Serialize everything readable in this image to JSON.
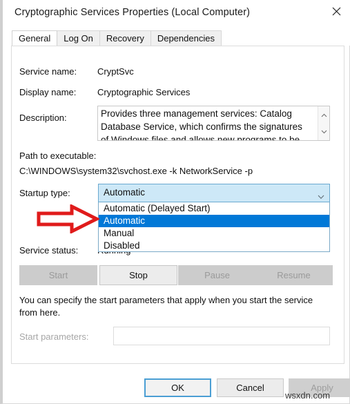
{
  "window": {
    "title": "Cryptographic Services Properties (Local Computer)",
    "close_icon": "close-icon"
  },
  "tabs": [
    {
      "label": "General",
      "active": true
    },
    {
      "label": "Log On",
      "active": false
    },
    {
      "label": "Recovery",
      "active": false
    },
    {
      "label": "Dependencies",
      "active": false
    }
  ],
  "general": {
    "service_name_label": "Service name:",
    "service_name_value": "CryptSvc",
    "display_name_label": "Display name:",
    "display_name_value": "Cryptographic Services",
    "description_label": "Description:",
    "description_value": "Provides three management services: Catalog Database Service, which confirms the signatures of Windows files and allows new programs to be",
    "path_label": "Path to executable:",
    "path_value": "C:\\WINDOWS\\system32\\svchost.exe -k NetworkService -p",
    "startup_type_label": "Startup type:",
    "startup_type_value": "Automatic",
    "startup_type_options": [
      {
        "label": "Automatic (Delayed Start)",
        "selected": false
      },
      {
        "label": "Automatic",
        "selected": true
      },
      {
        "label": "Manual",
        "selected": false
      },
      {
        "label": "Disabled",
        "selected": false
      }
    ],
    "service_status_label": "Service status:",
    "service_status_value": "Running",
    "buttons": [
      {
        "label": "Start",
        "enabled": false
      },
      {
        "label": "Stop",
        "enabled": true
      },
      {
        "label": "Pause",
        "enabled": false
      },
      {
        "label": "Resume",
        "enabled": false
      }
    ],
    "start_params_note": "You can specify the start parameters that apply when you start the service from here.",
    "start_params_label": "Start parameters:",
    "start_params_value": "",
    "start_params_placeholder": ""
  },
  "dialog_buttons": [
    {
      "label": "OK",
      "state": "primary"
    },
    {
      "label": "Cancel",
      "state": "normal"
    },
    {
      "label": "Apply",
      "state": "disabled"
    }
  ],
  "annotation": {
    "arrow_name": "red-arrow-pointing-to-automatic-option",
    "arrow_color": "#e01b1b"
  },
  "watermark": {
    "text": "wsxdn.com"
  },
  "colors": {
    "accent_selection": "#0078d7",
    "combo_hover": "#cde8f7",
    "focus_border": "#4a9ed4",
    "annotation_red": "#e01b1b"
  }
}
